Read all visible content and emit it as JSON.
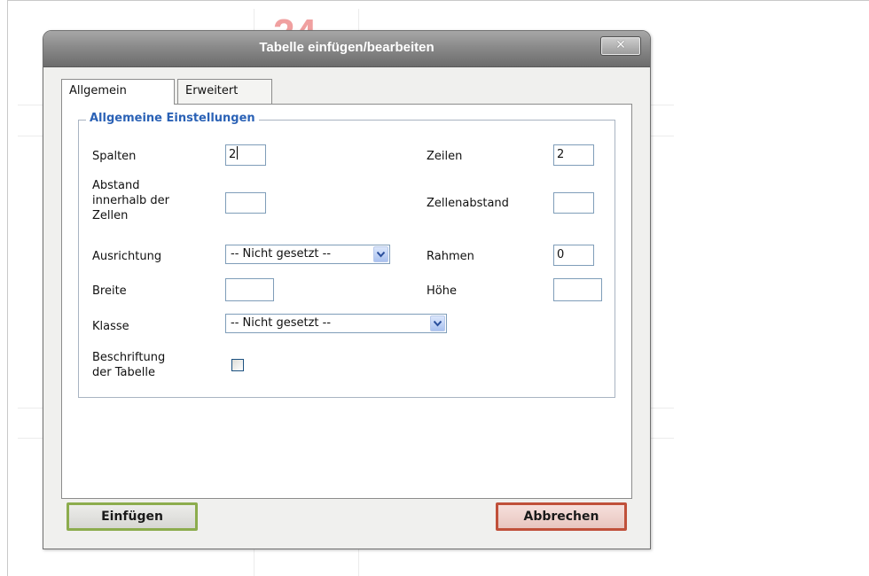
{
  "background": {
    "bg_text": "24"
  },
  "dialog": {
    "title": "Tabelle einfügen/bearbeiten",
    "close_symbol": "✕",
    "tabs": [
      {
        "label": "Allgemein",
        "active": true
      },
      {
        "label": "Erweitert",
        "active": false
      }
    ],
    "fieldset_legend": "Allgemeine Einstellungen",
    "fields": {
      "spalten": {
        "label": "Spalten",
        "value": "2"
      },
      "zeilen": {
        "label": "Zeilen",
        "value": "2"
      },
      "abstand": {
        "label_lines": [
          "Abstand",
          "innerhalb der",
          "Zellen"
        ],
        "value": ""
      },
      "zellenabstand": {
        "label": "Zellenabstand",
        "value": ""
      },
      "ausrichtung": {
        "label": "Ausrichtung",
        "selected": "-- Nicht gesetzt --"
      },
      "rahmen": {
        "label": "Rahmen",
        "value": "0"
      },
      "breite": {
        "label": "Breite",
        "value": ""
      },
      "hoehe": {
        "label": "Höhe",
        "value": ""
      },
      "klasse": {
        "label": "Klasse",
        "selected": "-- Nicht gesetzt --"
      },
      "beschriftung": {
        "label_lines": [
          "Beschriftung",
          "der Tabelle"
        ],
        "checked": false
      }
    },
    "buttons": {
      "insert": "Einfügen",
      "cancel": "Abbrechen"
    }
  },
  "colors": {
    "legend": "#2b62b6",
    "insert_border": "#8cac4d",
    "cancel_border": "#c0503a",
    "titlebar": "#8a8a8a"
  },
  "icons": {
    "close": "close-icon",
    "dropdown": "chevron-down-icon"
  }
}
